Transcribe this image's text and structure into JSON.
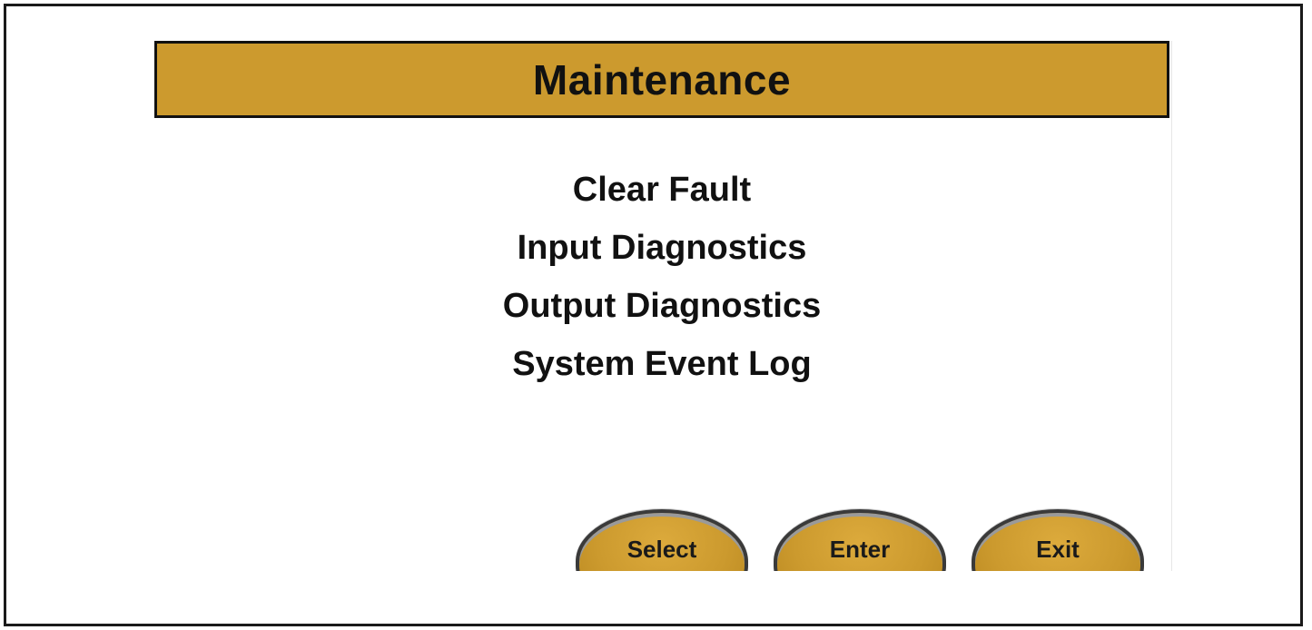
{
  "header": {
    "title": "Maintenance"
  },
  "menu": {
    "items": [
      {
        "label": "Clear Fault"
      },
      {
        "label": "Input Diagnostics"
      },
      {
        "label": "Output Diagnostics"
      },
      {
        "label": "System Event Log"
      }
    ]
  },
  "softkeys": {
    "select_label": "Select",
    "enter_label": "Enter",
    "exit_label": "Exit"
  },
  "colors": {
    "accent": "#cc9a2e",
    "text": "#111111",
    "background": "#ffffff"
  }
}
